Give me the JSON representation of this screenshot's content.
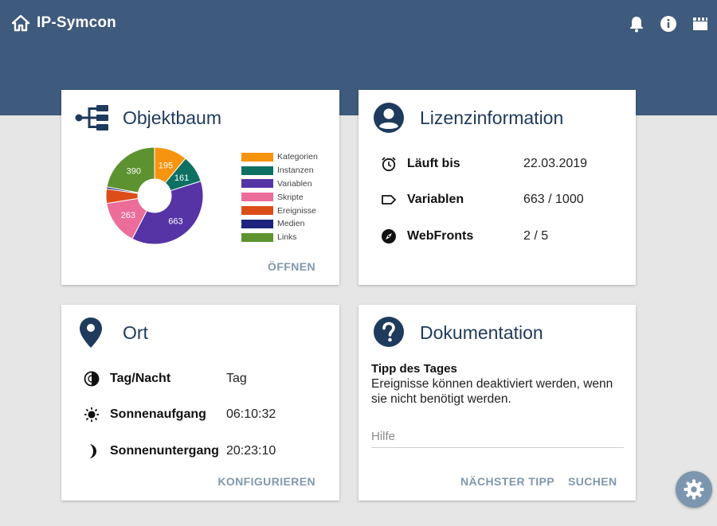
{
  "app": {
    "title": "IP-Symcon"
  },
  "objektbaum": {
    "title": "Objektbaum",
    "action": "ÖFFNEN"
  },
  "chart_data": {
    "type": "pie",
    "style": "donut",
    "title": "",
    "slices": [
      {
        "label": "Kategorien",
        "value": 195,
        "color": "#f7940f"
      },
      {
        "label": "Instanzen",
        "value": 161,
        "color": "#0d7063"
      },
      {
        "label": "Variablen",
        "value": 663,
        "color": "#5634a6"
      },
      {
        "label": "Skripte",
        "value": 263,
        "color": "#ec6c9a"
      },
      {
        "label": "Ereignisse",
        "value": 85,
        "color": "#dc4d18"
      },
      {
        "label": "Medien",
        "value": 12,
        "color": "#1b237d"
      },
      {
        "label": "Links",
        "value": 390,
        "color": "#5c922f"
      }
    ],
    "legend": "right"
  },
  "lizenz": {
    "title": "Lizenzinformation",
    "rows": [
      {
        "label": "Läuft bis",
        "value": "22.03.2019",
        "icon": "alarm-clock-icon"
      },
      {
        "label": "Variablen",
        "value": "663 / 1000",
        "icon": "label-tag-icon"
      },
      {
        "label": "WebFronts",
        "value": "2 / 5",
        "icon": "compass-icon"
      }
    ]
  },
  "ort": {
    "title": "Ort",
    "action": "KONFIGURIEREN",
    "rows": [
      {
        "label": "Tag/Nacht",
        "value": "Tag",
        "icon": "day-night-icon"
      },
      {
        "label": "Sonnenaufgang",
        "value": "06:10:32",
        "icon": "sun-icon"
      },
      {
        "label": "Sonnenuntergang",
        "value": "20:23:10",
        "icon": "moon-icon"
      }
    ]
  },
  "doku": {
    "title": "Dokumentation",
    "tip_title": "Tipp des Tages",
    "tip_text": "Ereignisse können deaktiviert werden, wenn sie nicht benötigt werden.",
    "search_placeholder": "Hilfe",
    "search_value": "",
    "next_tip": "NÄCHSTER TIPP",
    "search": "SUCHEN"
  },
  "colors": {
    "header": "#3e5a7c",
    "title": "#1e3a5c",
    "action": "#7f97ad",
    "background": "#e5e6e5"
  }
}
